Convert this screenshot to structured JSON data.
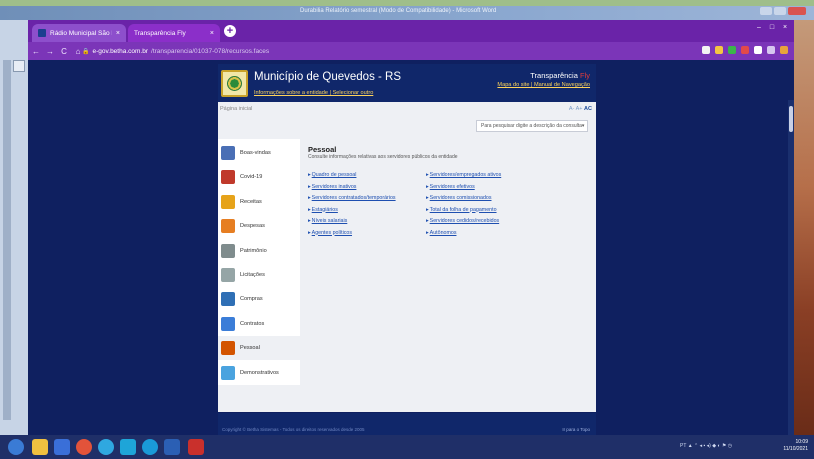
{
  "word": {
    "title": "Durabilia Relatório semestral (Modo de Compatibilidade) - Microsoft Word"
  },
  "browser": {
    "tabs": [
      {
        "label": "Rádio Municipal São Pedro",
        "close": "×"
      },
      {
        "label": "Transparência Fly",
        "close": "×"
      }
    ],
    "newtab": "+",
    "window_controls": [
      "–",
      "□",
      "×"
    ],
    "nav": {
      "back": "←",
      "forward": "→",
      "reload": "C",
      "home": "⌂"
    },
    "url": {
      "host": "e-gov.betha.com.br",
      "path": "/transparencia/01037-078/recursos.faces",
      "lock": "🔒"
    }
  },
  "site": {
    "municipality": "Município de Quevedos - RS",
    "municipality_links": "Informações sobre a entidade | Selecionar outro",
    "transparencia": "Transparência",
    "transparencia_fy": "Fly",
    "header_links": "Mapa do site | Manual de Navegação",
    "breadcrumb": "Página inicial",
    "font_size_controls": {
      "decrease": "A-",
      "increase": "A+",
      "contrast": "AC"
    },
    "search_placeholder": "Para pesquisar digite a descrição da consulta",
    "search_caret": "▾"
  },
  "sidebar": {
    "items": [
      {
        "label": "Boas-vindas",
        "color": "#4a6fb5",
        "icon": "welcome-icon"
      },
      {
        "label": "Covid-19",
        "color": "#c0392b",
        "icon": "virus-icon"
      },
      {
        "label": "Receitas",
        "color": "#e6a31a",
        "icon": "revenue-icon"
      },
      {
        "label": "Despesas",
        "color": "#e67e22",
        "icon": "expense-icon"
      },
      {
        "label": "Patrimônio",
        "color": "#7f8c8d",
        "icon": "building-icon"
      },
      {
        "label": "Licitações",
        "color": "#95a5a6",
        "icon": "gavel-icon"
      },
      {
        "label": "Compras",
        "color": "#2f6fb5",
        "icon": "cart-icon"
      },
      {
        "label": "Contratos",
        "color": "#3b7dd8",
        "icon": "contract-icon"
      },
      {
        "label": "Pessoal",
        "color": "#d35400",
        "icon": "people-icon"
      },
      {
        "label": "Demonstrativos",
        "color": "#4aa3df",
        "icon": "report-icon"
      }
    ],
    "active_index": 8
  },
  "main": {
    "title": "Pessoal",
    "subtitle": "Consulte informações relativas aos servidores públicos da entidade",
    "col1": [
      "Quadro de pessoal",
      "Servidores inativos",
      "Servidores contratados/temporários",
      "Estagiários",
      "Níveis salariais",
      "Agentes políticos"
    ],
    "col2": [
      "Servidores/empregados ativos",
      "Servidores efetivos",
      "Servidores comissionados",
      "Total da folha de pagamento",
      "Servidores cedidos/recebidos",
      "Autônomos"
    ]
  },
  "footer": {
    "left": "Copyright © Betha Sistemas - Todos os direitos reservados desde 2005",
    "right": "Ir para o Topo"
  },
  "taskbar": {
    "clock_time": "10:09",
    "clock_date": "11/10/2021",
    "tray": "PT ▲ ⌃ ◂ ▪ ◂) ◆ ◐ ⚑ ◷"
  }
}
